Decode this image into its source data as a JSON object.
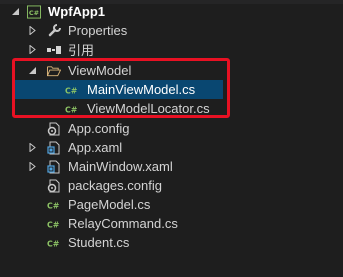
{
  "tree": {
    "project": {
      "label": "WpfApp1",
      "badge": "C#"
    },
    "items": [
      {
        "label": "Properties"
      },
      {
        "label": "引用"
      },
      {
        "label": "ViewModel"
      },
      {
        "label": "MainViewModel.cs",
        "badge": "C#"
      },
      {
        "label": "ViewModelLocator.cs",
        "badge": "C#"
      },
      {
        "label": "App.config"
      },
      {
        "label": "App.xaml"
      },
      {
        "label": "MainWindow.xaml"
      },
      {
        "label": "packages.config"
      },
      {
        "label": "PageModel.cs",
        "badge": "C#"
      },
      {
        "label": "RelayCommand.cs",
        "badge": "C#"
      },
      {
        "label": "Student.cs",
        "badge": "C#"
      }
    ]
  },
  "colors": {
    "background": "#1e1e1e",
    "selection": "#094771",
    "highlight_border": "#e81123",
    "csharp_green": "#8cc265",
    "folder_yellow": "#dcb67a"
  }
}
